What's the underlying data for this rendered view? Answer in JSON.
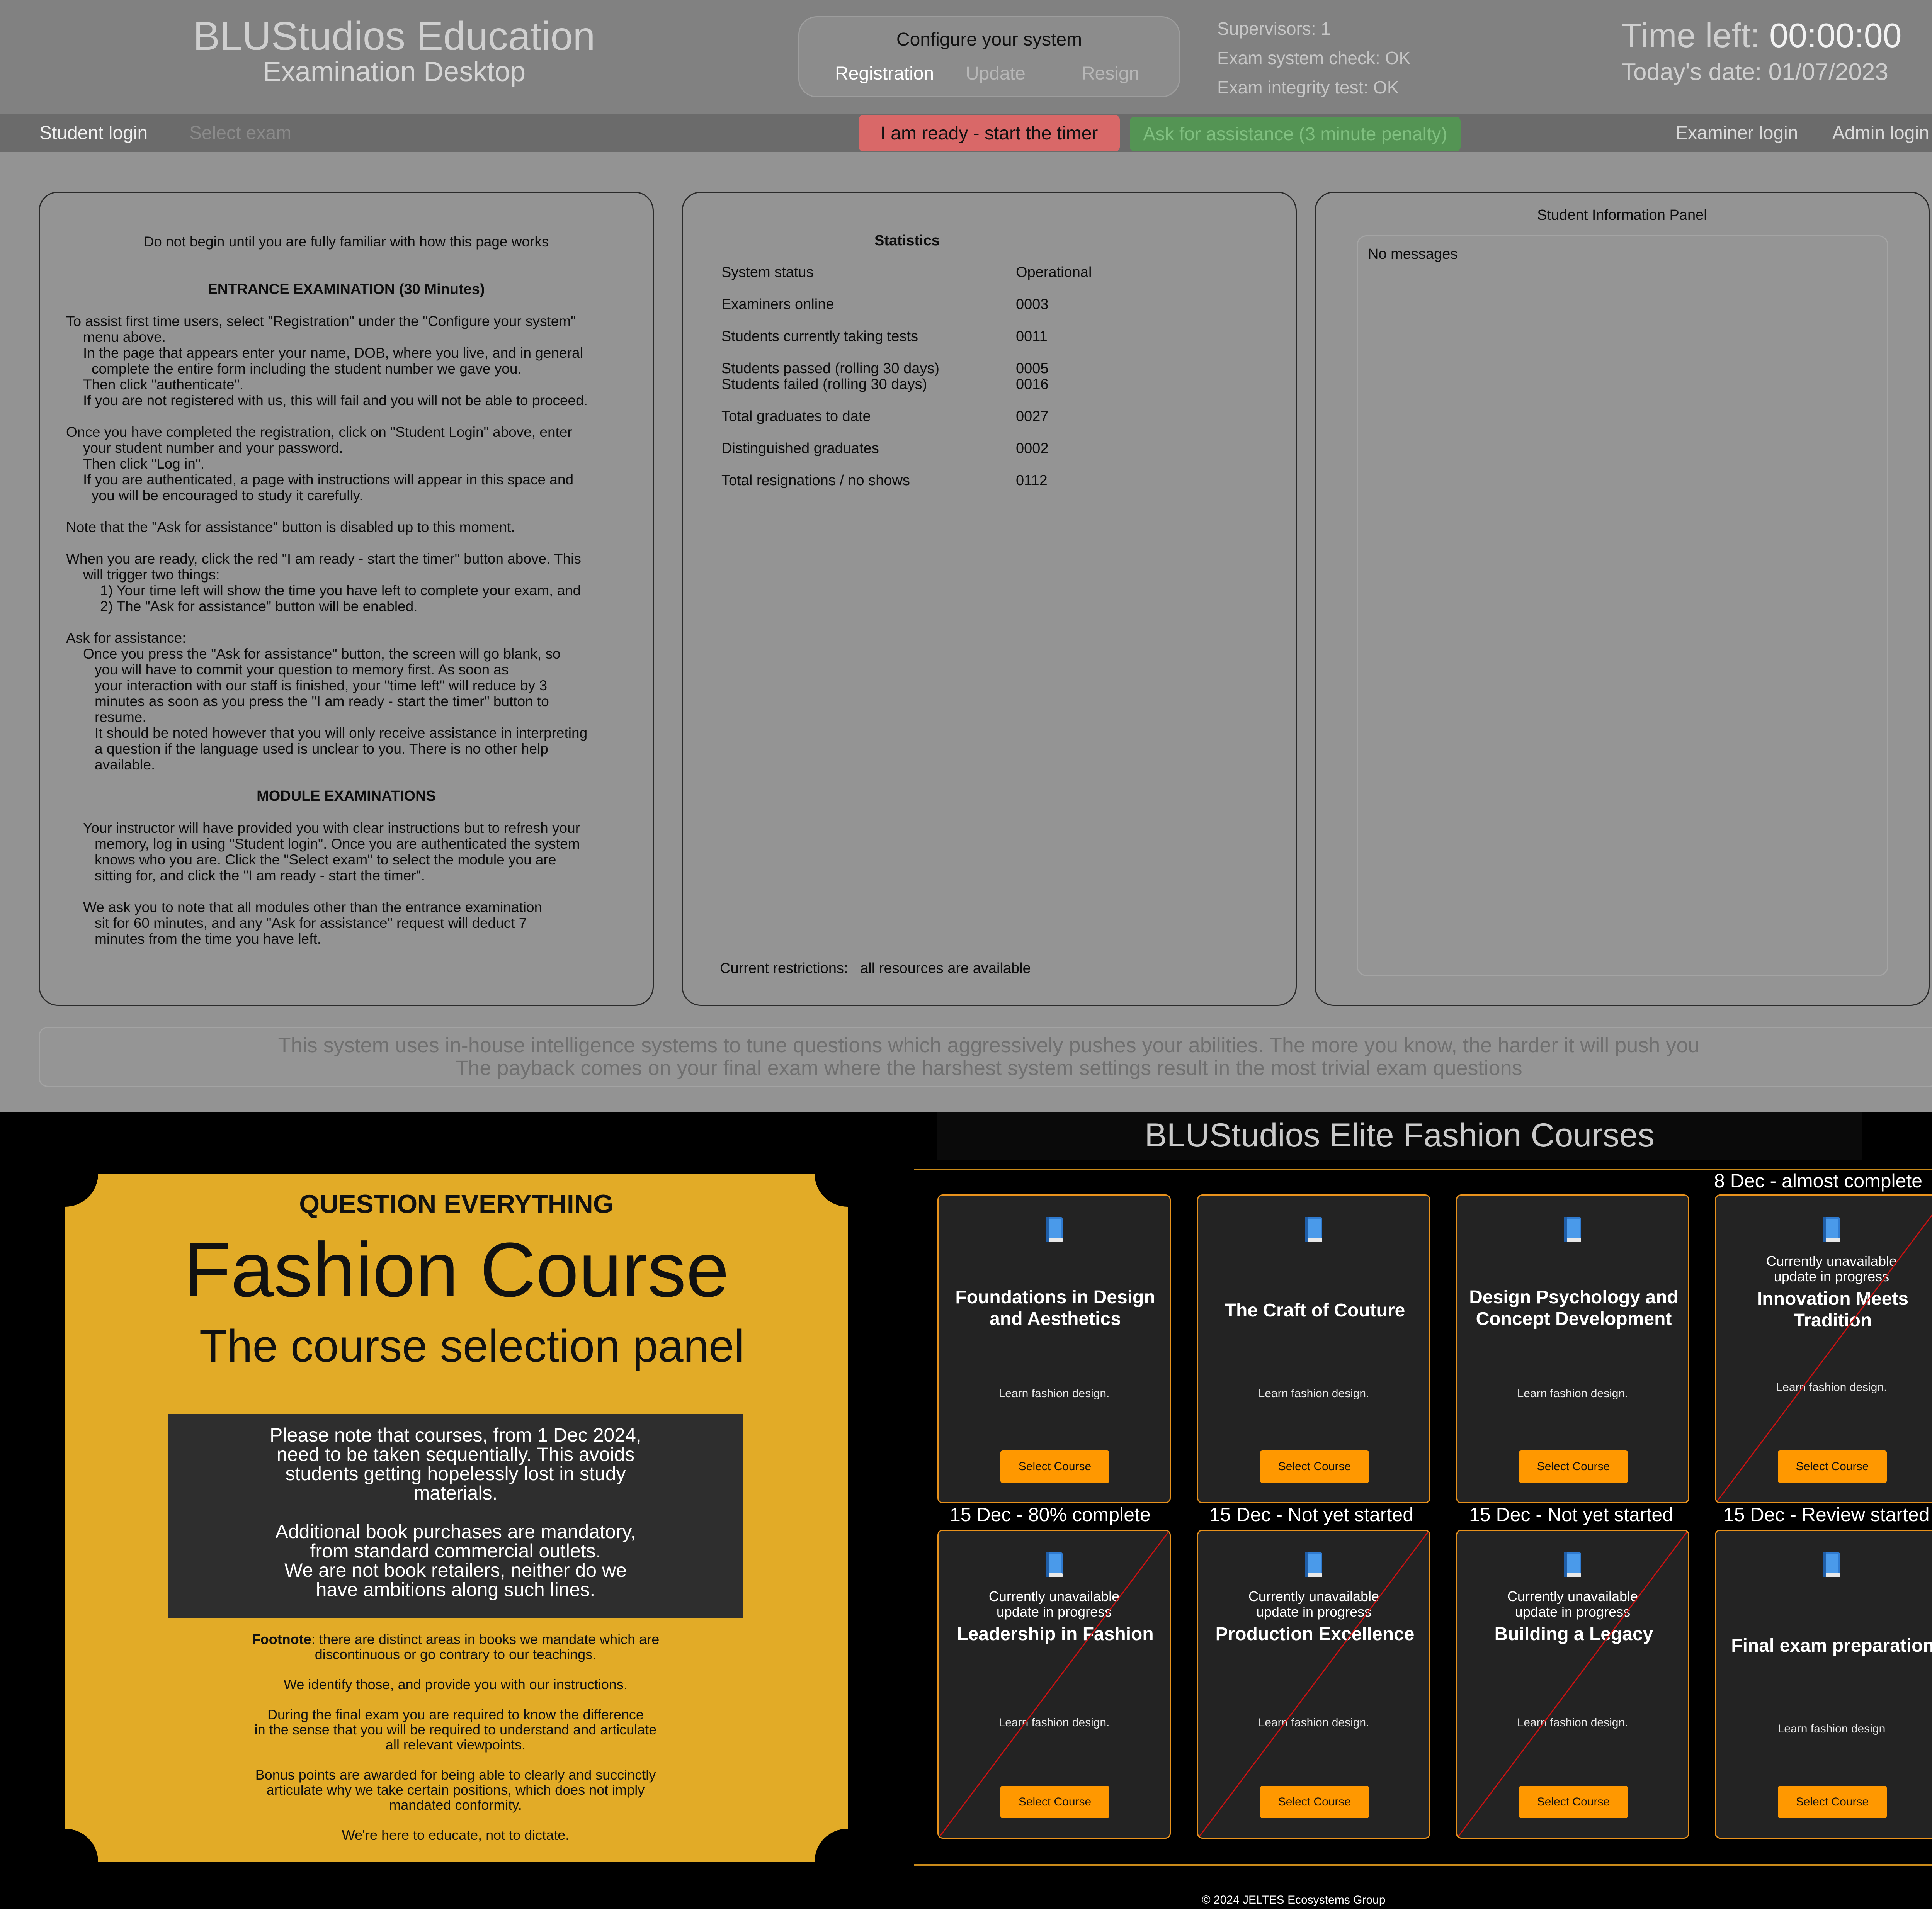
{
  "header": {
    "brand_title": "BLUStudios Education",
    "brand_subtitle": "Examination Desktop",
    "config_title": "Configure your system",
    "config_items": [
      "Registration",
      "Update",
      "Resign"
    ],
    "supervisors": "Supervisors: 1",
    "system_check": "Exam system check: OK",
    "integrity_test": "Exam integrity test: OK",
    "time_left_label": "Time left:",
    "time_left_value": "00:00:00",
    "today_date": "Today's date: 01/07/2023"
  },
  "nav": {
    "student_login": "Student login",
    "select_exam": "Select exam",
    "ready_button": "I am ready - start the timer",
    "assist_button": "Ask for assistance (3 minute penalty)",
    "examiner_login": "Examiner login",
    "admin_login": "Admin login"
  },
  "instructions": {
    "intro": "Do not begin until you are fully familiar with how this page works",
    "heading_entrance": "ENTRANCE EXAMINATION (30 Minutes)",
    "lines": [
      "To assist first time users, select \"Registration\" under the \"Configure your system\"",
      "menu above.",
      "In the page that appears enter your name, DOB, where you live, and in general",
      "complete the entire form including the student number we gave you.",
      "Then click \"authenticate\".",
      "If you are not registered with us, this will fail and you will not be able to proceed.",
      "Once you have completed the registration, click on \"Student Login\" above, enter",
      "your student number and your password.",
      "Then click \"Log in\".",
      "If you are authenticated, a page with instructions will appear in this space and",
      "you will be encouraged to study it carefully.",
      "Note that the \"Ask for assistance\" button is disabled up to this moment.",
      "When you are ready, click the red \"I am ready - start the timer\" button above. This",
      "will trigger two things:",
      "1) Your time left will show the time you have left to complete your exam, and",
      "2) The \"Ask for assistance\" button will be enabled.",
      "Ask for assistance:",
      "Once you press the \"Ask for assistance\" button, the screen will go blank, so",
      "you will have to commit your question to memory first. As soon as",
      "your interaction with our staff is finished, your \"time left\" will reduce by 3",
      "minutes as soon as you press the \"I am ready - start the timer\" button to",
      "resume.",
      "It should be noted however that you will only receive assistance in interpreting",
      "a question if the language used is unclear to you. There is no other help",
      "available."
    ],
    "heading_modules": "MODULE EXAMINATIONS",
    "module_lines": [
      "Your instructor will have provided you with clear instructions but to refresh your",
      "memory, log in using \"Student login\". Once you are authenticated the system",
      "knows who you are. Click the \"Select exam\" to select the module you are",
      "sitting for, and click the \"I am ready - start the timer\".",
      "We ask you to note that all modules other than the entrance examination",
      "sit for 60 minutes, and any \"Ask for assistance\" request will deduct 7",
      "minutes from the time you have left."
    ]
  },
  "statistics": {
    "title": "Statistics",
    "rows": [
      {
        "label": "System status",
        "value": "Operational"
      },
      {
        "label": "Examiners online",
        "value": "0003"
      },
      {
        "label": "Students currently taking tests",
        "value": "0011"
      },
      {
        "label": "Students passed (rolling 30 days)",
        "value": "0005"
      },
      {
        "label": "Students failed (rolling 30 days)",
        "value": "0016"
      },
      {
        "label": "Total graduates to date",
        "value": "0027"
      },
      {
        "label": "Distinguished graduates",
        "value": "0002"
      },
      {
        "label": "Total resignations / no shows",
        "value": "0112"
      }
    ],
    "restrictions_label": "Current restrictions:",
    "restrictions_value": "all resources are available"
  },
  "info_panel": {
    "title": "Student  Information Panel",
    "message": "No messages"
  },
  "notice": {
    "line1": "This system uses in-house intelligence systems to tune questions which aggressively pushes your abilities. The more you know, the harder it will push you",
    "line2": "The payback comes on your final exam where the harshest system settings result in the most trivial exam questions"
  },
  "poster": {
    "kicker": "QUESTION EVERYTHING",
    "title": "Fashion Course",
    "subtitle": "The course selection panel",
    "box_lines": [
      "Please note that courses, from 1 Dec 2024,",
      "need to be taken sequentially. This avoids",
      "students getting hopelessly lost in study",
      "materials.",
      "",
      "Additional book purchases are mandatory,",
      "from standard commercial outlets.",
      "We are not book retailers, neither do we",
      "have ambitions along such lines."
    ],
    "footnote_label": "Footnote",
    "footnote_lines": [
      ": there are distinct areas in books we mandate which are",
      "discontinuous or go contrary to our teachings.",
      "We identify those, and provide you with our instructions.",
      "During the final exam you are required to know the difference",
      "in the sense that you will be required to understand and articulate",
      "all relevant viewpoints.",
      "Bonus points are awarded for being able to clearly and succinctly",
      "articulate why we take certain positions, which does not imply",
      "mandated conformity.",
      "We're here to educate, not to dictate."
    ]
  },
  "courses": {
    "title": "BLUStudios Elite Fashion Courses",
    "unavailable_line1": "Currently unavailable",
    "unavailable_line2": "update in progress",
    "button_label": "Select Course",
    "status_row1": "8 Dec - almost complete",
    "status_row2": [
      "15 Dec - 80% complete",
      "15 Dec - Not yet started",
      "15 Dec - Not yet started",
      "15 Dec - Review started"
    ],
    "items": [
      {
        "title": "Foundations in Design and Aesthetics",
        "desc": "Learn fashion design.",
        "unavailable": false
      },
      {
        "title": "The Craft of Couture",
        "desc": "Learn fashion design.",
        "unavailable": false
      },
      {
        "title": "Design Psychology and Concept Development",
        "desc": "Learn fashion design.",
        "unavailable": false
      },
      {
        "title": "Innovation Meets Tradition",
        "desc": "Learn fashion design.",
        "unavailable": true
      },
      {
        "title": "Leadership in Fashion",
        "desc": "Learn fashion design.",
        "unavailable": true
      },
      {
        "title": "Production Excellence",
        "desc": "Learn fashion design.",
        "unavailable": true
      },
      {
        "title": "Building a Legacy",
        "desc": "Learn fashion design.",
        "unavailable": true
      },
      {
        "title": "Final exam preparation",
        "desc": "Learn fashion design",
        "unavailable": false
      }
    ],
    "copyright": "© 2024 JELTES Ecosystems Group"
  },
  "colors": {
    "accent_orange": "#ff9800",
    "card_border": "#e9921c",
    "poster_yellow": "#e2ab27",
    "ready_red": "#d96868",
    "assist_green": "#549454",
    "strike_red": "#cc1111"
  },
  "icons": [
    "book-icon"
  ]
}
